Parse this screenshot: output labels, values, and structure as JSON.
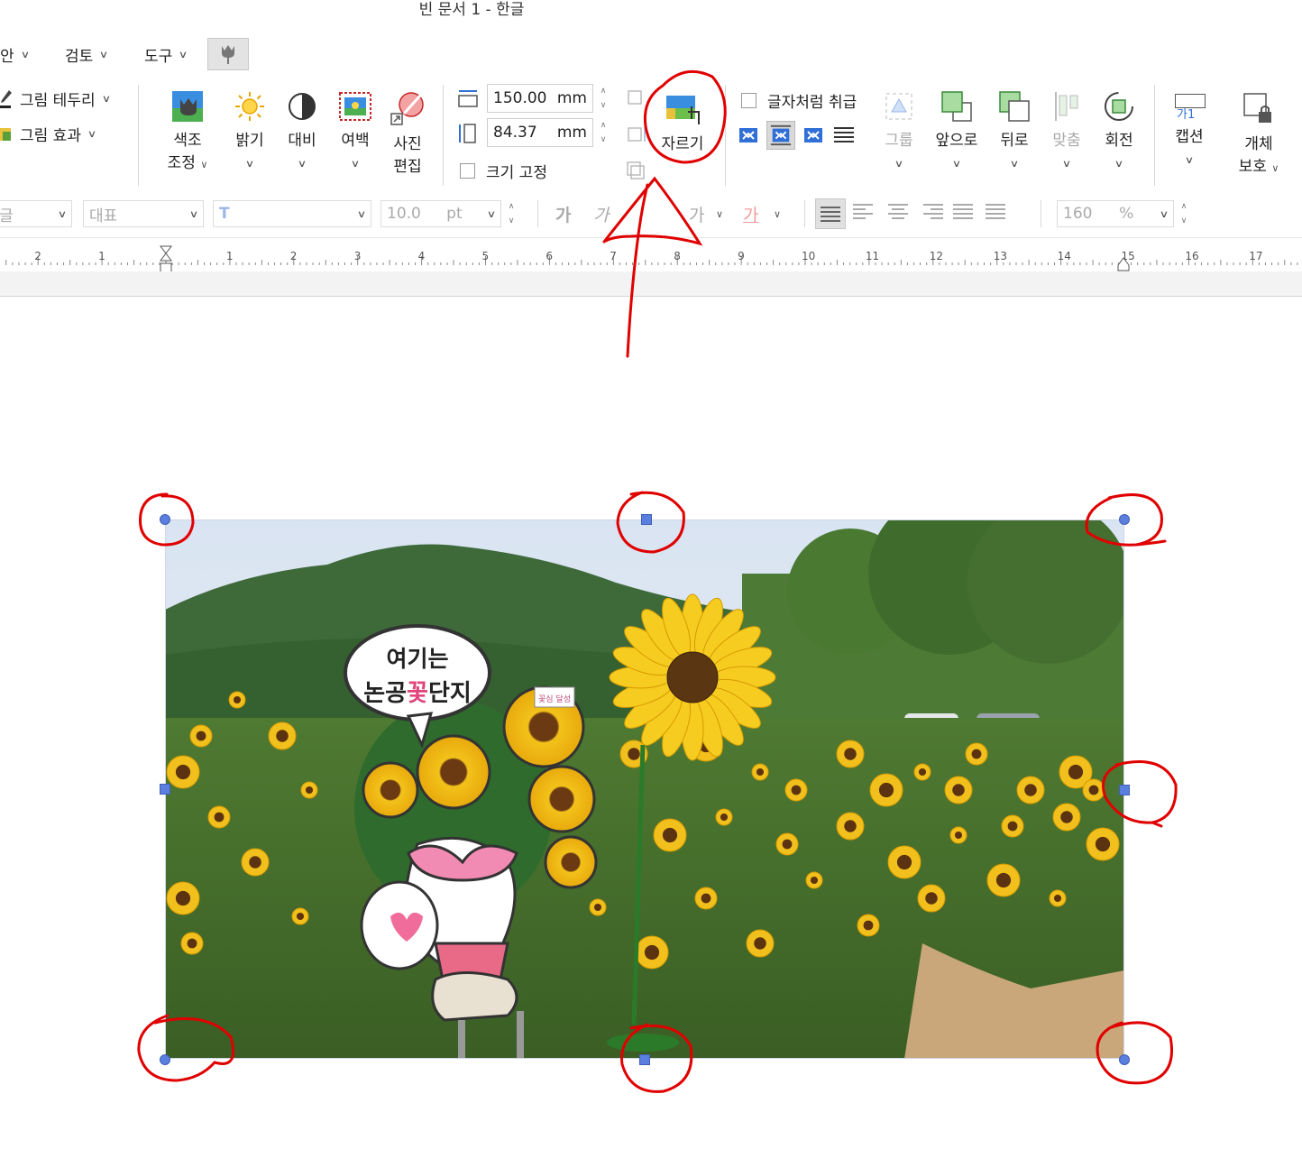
{
  "window": {
    "title": "빈 문서 1 - 한글"
  },
  "menu": {
    "items": [
      {
        "label": "안"
      },
      {
        "label": "검토"
      },
      {
        "label": "도구"
      }
    ]
  },
  "ribbon": {
    "border_label": "그림 테두리",
    "effect_label": "그림 효과",
    "color_adjust": {
      "line1": "색조",
      "line2": "조정"
    },
    "brightness": "밝기",
    "contrast": "대비",
    "margin": "여백",
    "photo_edit": {
      "line1": "사진",
      "line2": "편집"
    },
    "width": {
      "value": "150.00",
      "unit": "mm"
    },
    "height": {
      "value": "84.37",
      "unit": "mm"
    },
    "lock_size": "크기 고정",
    "crop": "자르기",
    "treat_as_char": "글자처럼 취급",
    "group": "그룹",
    "bring_forward": "앞으로",
    "send_backward": "뒤로",
    "align": "맞춤",
    "rotate": "회전",
    "caption": "캡션",
    "caption_icon_text": "가1",
    "protect": {
      "line1": "개체",
      "line2": "보호"
    }
  },
  "formatting": {
    "style_value": "대표",
    "font_size": "10.0",
    "font_unit": "pt",
    "char_bold": "가",
    "char_italic": "가",
    "char_underline": "가",
    "char_color": "가",
    "line_spacing": "160",
    "line_spacing_unit": "%"
  },
  "ruler": {
    "labels": [
      "2",
      "1",
      "1",
      "2",
      "3",
      "4",
      "5",
      "6",
      "7",
      "8",
      "9",
      "10",
      "11",
      "12",
      "13",
      "14",
      "15",
      "16",
      "17"
    ]
  },
  "image": {
    "bubble_line1": "여기는",
    "bubble_line2_a": "논공",
    "bubble_line2_b": "꽃",
    "bubble_line2_c": "단지",
    "sign_text": "꽃심 달성"
  },
  "colors": {
    "annotation": "#e00000",
    "handle": "#5b7fde",
    "accent": "#2f6fd6"
  }
}
